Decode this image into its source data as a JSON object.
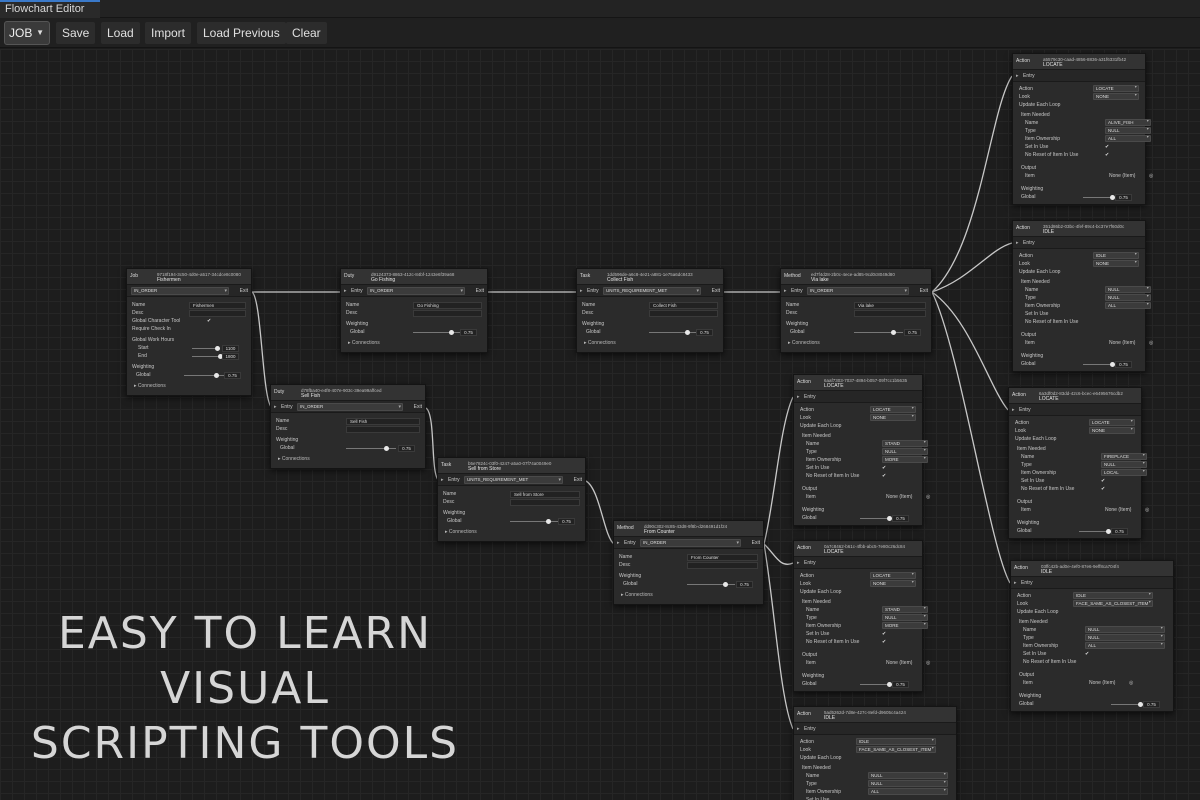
{
  "window": {
    "title": "Flowchart Editor"
  },
  "toolbar": {
    "job_select": "JOB",
    "buttons": [
      "Save",
      "Load",
      "Import",
      "Load Previous",
      "Clear"
    ]
  },
  "labels": {
    "exit": "Exit",
    "entry": "Entry",
    "connections": "Connections",
    "name": "Name",
    "desc": "Desc",
    "weighting": "Weighting",
    "global": "Global",
    "global_char_tool": "Global Character Tool",
    "require_check_in": "Require Check In",
    "global_work_hours": "Global Work Hours",
    "start": "Start",
    "end": "End",
    "action": "Action",
    "look": "Look",
    "update_each_loop": "Update Each Loop",
    "item_needed": "Item Needed",
    "type": "Type",
    "item_ownership": "Item Ownership",
    "set_in_use": "Set In Use",
    "no_reset": "No Reset of Item In Use",
    "output": "Output",
    "item": "Item"
  },
  "nodes": {
    "job": {
      "kind": "Job",
      "id": "9718f194-3c50-4d0e-a517-34cdce8c0080",
      "title": "Fishermen",
      "mode": "IN_ORDER",
      "name": "Fishermen",
      "start": "1100",
      "end": "1800",
      "weight": "0.75",
      "check": "✔"
    },
    "duty1": {
      "kind": "Duty",
      "id": "d9124373-8863-412c-84bf-1243e6f39a68",
      "title": "Go Fishing",
      "mode": "IN_ORDER",
      "name": "Go Fishing",
      "weight": "0.75"
    },
    "task1": {
      "kind": "Task",
      "id": "1dd596de-a6c8-4e21-a881-1e75a6dc8433",
      "title": "Collect Fish",
      "mode": "UNITS_REQUIREMENT_MET",
      "name": "Collect Fish",
      "weight": "0.75"
    },
    "method1": {
      "kind": "Method",
      "id": "ed7f4d28-2b0c-4ece-ad85-9cd0c8049d80",
      "title": "Via lake",
      "mode": "IN_ORDER",
      "name": "Via lake",
      "weight": "0.75"
    },
    "duty2": {
      "kind": "Duty",
      "id": "d78fba40-e4f8-407e-903c-39ea99affced",
      "title": "Sell Fish",
      "mode": "IN_ORDER",
      "name": "Sell Fish",
      "weight": "0.75"
    },
    "task2": {
      "kind": "Task",
      "id": "b5e7824c-03f0-4247-a5a0-07f74a0049e0",
      "title": "Sell from Store",
      "mode": "UNITS_REQUIREMENT_MET",
      "name": "Sell from Store",
      "weight": "0.75"
    },
    "method2": {
      "kind": "Method",
      "id": "dd90c302-8c85-43d8-9f8b-d268491d1f24",
      "title": "From Counter",
      "mode": "IN_ORDER",
      "name": "From Counter",
      "weight": "0.75"
    }
  },
  "actions": [
    {
      "id": "a5579c30-caad-4856-8836-a31f6331fb42",
      "title": "LOCATE",
      "action": "LOCATE",
      "look": "NONE",
      "name": "ALIVE_FISH",
      "type": "NULL",
      "ownership": "ALL",
      "set_in_use": "✔",
      "no_reset": "✔",
      "item": "None (Item)",
      "weight": "0.75"
    },
    {
      "id": "351d86b2-03bc-4fef-89c4-bc37e7f60d0c",
      "title": "IDLE",
      "action": "IDLE",
      "look": "NONE",
      "name": "NULL",
      "type": "NULL",
      "ownership": "ALL",
      "set_in_use": "",
      "no_reset": "",
      "item": "None (Item)",
      "weight": "0.75"
    },
    {
      "id": "6a3df0d2-83dd-42c6-bcec-e6495676cdb2",
      "title": "LOCATE",
      "action": "LOCATE",
      "look": "NONE",
      "name": "FIREPLACE",
      "type": "NULL",
      "ownership": "LOCAL",
      "set_in_use": "✔",
      "no_reset": "✔",
      "item": "None (Item)",
      "weight": "0.75"
    },
    {
      "id": "03ffc42b-ad0e-4ef0-87e6-9eff8ca704f4",
      "title": "IDLE",
      "action": "IDLE",
      "look": "FACE_SAME_AS_CLOSEST_ITEM",
      "name": "NULL",
      "type": "NULL",
      "ownership": "ALL",
      "set_in_use": "✔",
      "no_reset": "",
      "item": "None (Item)",
      "weight": "0.75"
    },
    {
      "id": "6aaf7303-7037-4894-b057-09f7cc1b5635",
      "title": "LOCATE",
      "action": "LOCATE",
      "look": "NONE",
      "name": "STAND",
      "type": "NULL",
      "ownership": "MORE",
      "set_in_use": "✔",
      "no_reset": "✔",
      "item": "None (Item)",
      "weight": "0.75"
    },
    {
      "id": "0a7c8462-b61c-4fbb-abc5-7e80c26dc84",
      "title": "LOCATE",
      "action": "LOCATE",
      "look": "NONE",
      "name": "STAND",
      "type": "NULL",
      "ownership": "MORE",
      "set_in_use": "✔",
      "no_reset": "✔",
      "item": "None (Item)",
      "weight": "0.75"
    },
    {
      "id": "5ad5262d-7d8e-427c-8efd-d9605c4a424",
      "title": "IDLE",
      "action": "IDLE",
      "look": "FACE_SAME_AS_CLOSEST_ITEM",
      "name": "NULL",
      "type": "NULL",
      "ownership": "ALL",
      "set_in_use": "",
      "no_reset": "",
      "item": "",
      "weight": ""
    }
  ],
  "promo": {
    "line1": "EASY TO LEARN",
    "line2": "VISUAL",
    "line3": "SCRIPTING TOOLS"
  }
}
